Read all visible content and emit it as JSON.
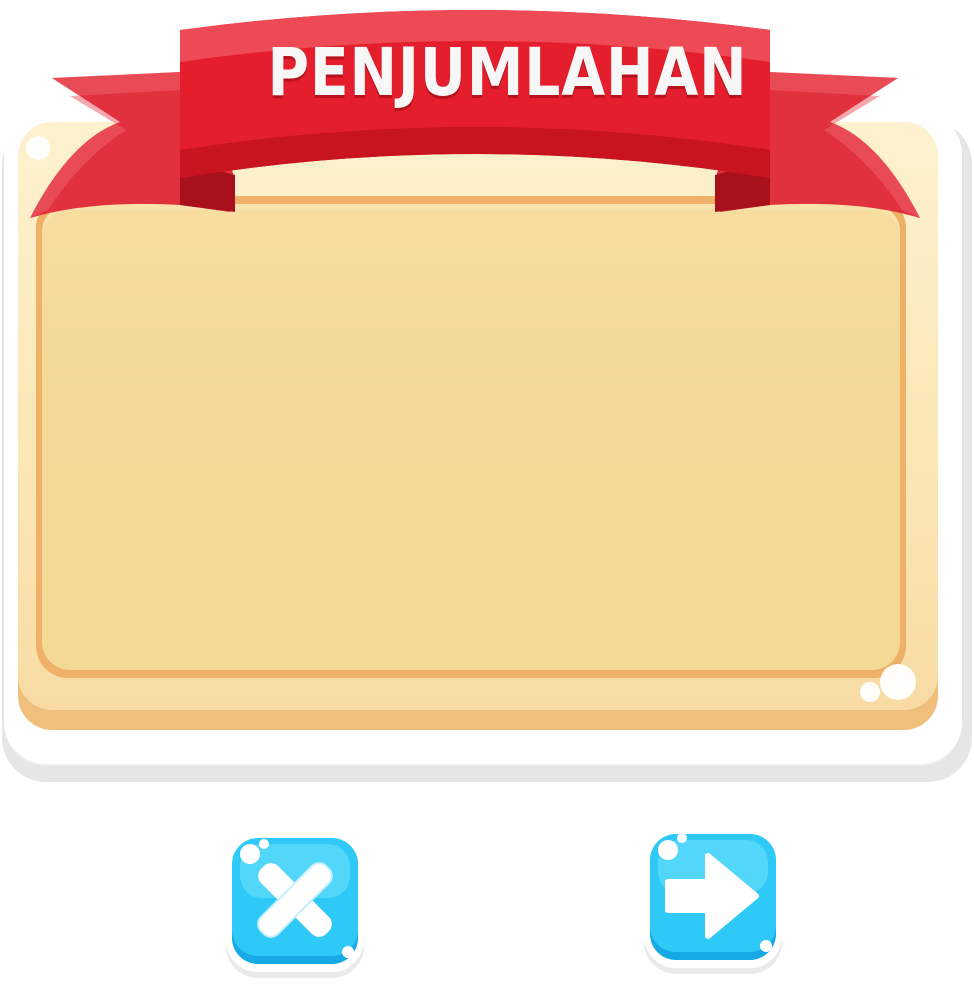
{
  "ribbon": {
    "title": "PENJUMLAHAN",
    "color": "#e52a34"
  },
  "panel": {
    "face_color": "#fbe7b6",
    "inner_color": "#f3d995",
    "rim_color": "#efb068"
  },
  "buttons": {
    "close": {
      "icon": "close-icon",
      "color": "#26c6f2"
    },
    "next": {
      "icon": "arrow-right-icon",
      "color": "#26c6f2"
    }
  }
}
